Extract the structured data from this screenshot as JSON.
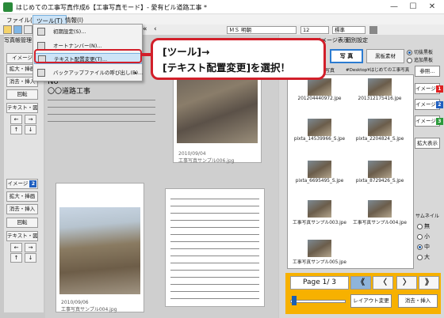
{
  "window": {
    "title": "はじめての工事写真作成6【工事写真モード】- 愛有ビル道路工事 *",
    "minimize": "—",
    "maximize": "☐",
    "close": "✕"
  },
  "menubar": {
    "file": "ファイル(F)",
    "tool": "ツール(T)",
    "info": "情報(I)"
  },
  "toolbar": {
    "font_name": "ＭＳ 明朝",
    "font_size": "12",
    "style": "標準"
  },
  "tabs": {
    "management": "写真帳管理",
    "image_display": "イメージ表示",
    "individual": "個別設定"
  },
  "tool_menu": {
    "items": [
      {
        "label": "初期設定(S)..."
      },
      {
        "label": "オートナンバー(N)..."
      },
      {
        "label": "テキスト配置変更(T)..."
      },
      {
        "label": "バックアップファイルの呼び出し(B)..."
      }
    ]
  },
  "callout": {
    "line1": "[ツール]→",
    "line2": "[テキスト配置変更]を選択！"
  },
  "left_panel": {
    "top": {
      "image_label": "イメージ",
      "insert": "拡大・挿画",
      "delete_insert": "消去・挿入",
      "rotate": "回転",
      "text": "テキスト・図",
      "num": "1"
    },
    "bottom": {
      "image_label": "イメージ",
      "num": "2",
      "enlarge_insert": "拡大・挿画",
      "delete_insert": "消去・挿入",
      "rotate": "回転",
      "text": "テキスト・図"
    },
    "arrows": {
      "left": "←",
      "right": "→",
      "up": "↑",
      "down": "↓"
    }
  },
  "page_content": {
    "no_label": "No",
    "road_work": "〇〇道路工事",
    "photo1_date": "2010/09/04",
    "photo1_caption": "工事写真サンプル006.jpg",
    "photo2_date": "2010/09/06",
    "photo2_caption": "工事写真サンプル004.jpg"
  },
  "right_panel": {
    "photo_button": "写 真",
    "blackboard_button": "黒板素材",
    "cut_board": "切抜黒板",
    "add_board": "追加黒板",
    "folder_label": "工事写真",
    "folder_path": "#Desktop¥はじめての工事写真",
    "reference": "参照..."
  },
  "gallery": [
    {
      "name": "201204440972.jpe"
    },
    {
      "name": "201312175416.jpe"
    },
    {
      "name": "pixta_14539966_S.jpe"
    },
    {
      "name": "pixta_2204824_S.jpe"
    },
    {
      "name": "pixta_6695495_S.jpe"
    },
    {
      "name": "pixta_8729426_S.jpe"
    },
    {
      "name": "工事写真サンプル003.jpe"
    },
    {
      "name": "工事写真サンプル004.jpe"
    },
    {
      "name": "工事写真サンプル005.jpe"
    }
  ],
  "side_buttons": {
    "image": "イメージ",
    "n1": "1",
    "n2": "2",
    "n3": "3",
    "enlarge": "拡大表示",
    "thumbnail_label": "サムネイル",
    "none": "無",
    "small": "小",
    "medium": "中",
    "large": "大"
  },
  "bottom_bar": {
    "page_label": "Page  1/ 3",
    "first": "《",
    "prev": "〈",
    "next": "〉",
    "last": "》",
    "layout_change": "レイアウト変更",
    "delete_insert": "消去・挿入",
    "colors": {
      "accent": "#f7b100",
      "badge1": "#e02020",
      "badge2": "#1f5fc0",
      "badge3": "#2a9a3a"
    }
  }
}
